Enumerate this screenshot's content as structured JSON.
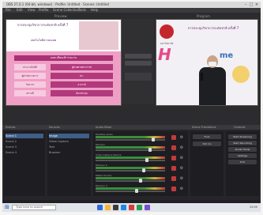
{
  "window": {
    "title": "OBS 27.0.1 (64-bit, windows) - Profile: Untitled - Scenes: Untitled",
    "menu": [
      "File",
      "Edit",
      "View",
      "Profile",
      "Scene Collection",
      "Tools",
      "Help"
    ]
  },
  "panes": {
    "preview_label": "Preview",
    "program_label": "Program"
  },
  "preview": {
    "banner_title": "การประชุมวิชาการระดับชาติ ครั้งที่ 7",
    "banner_sub": "เทคโนโลยีสารสนเทศ",
    "bar_text": "ลงทะเบียนเข้าร่วมงาน",
    "rows": [
      {
        "label": "ประธานในพิธี",
        "value": "ผู้ช่วยศาสตราจารย์"
      },
      {
        "label": "ผู้ดำเนินรายการ",
        "value": "ดร."
      },
      {
        "label": "วิทยากร",
        "value": "อาจารย์"
      },
      {
        "label": "สถานที่",
        "value": "ห้องประชุม"
      }
    ]
  },
  "program": {
    "title": "การประชุมวิชาการระดับชาติ ครั้งที่ 7",
    "logo_text": "มหาวิทยาลัย",
    "art_text": "H",
    "art_text2": "me"
  },
  "center": {
    "quick_transitions": "Quick Transitions",
    "fade": "Fade",
    "cut": "Cut"
  },
  "docks": {
    "headers": [
      "Scenes",
      "Sources",
      "Audio Mixer",
      "Scene Transitions",
      "Controls"
    ],
    "scenes": [
      "Scene 1",
      "Scene 2",
      "Scene 3",
      "Scene 4"
    ],
    "sources": [
      "Image",
      "Video Capture",
      "Text",
      "Browser"
    ],
    "mixer": [
      {
        "name": "Desktop Audio",
        "level": 0.85
      },
      {
        "name": "Mic/Aux",
        "level": 0.8
      },
      {
        "name": "Video Capture Device",
        "level": 0.75
      },
      {
        "name": "Mic/Aux 2",
        "level": 0.7
      },
      {
        "name": "Media Source",
        "level": 0.65
      },
      {
        "name": "Mic/Aux 3",
        "level": 0.6
      }
    ],
    "transitions": {
      "type": "Fade",
      "duration": "300 ms"
    },
    "controls": [
      "Start Streaming",
      "Start Recording",
      "Studio Mode",
      "Settings",
      "Exit"
    ]
  },
  "status": {
    "text": "LIVE: 00:00:00  REC: 00:00:00  CPU: 12.0%, 30.00 fps"
  },
  "taskbar": {
    "search_placeholder": "Type here to search",
    "clock": "13:05"
  }
}
